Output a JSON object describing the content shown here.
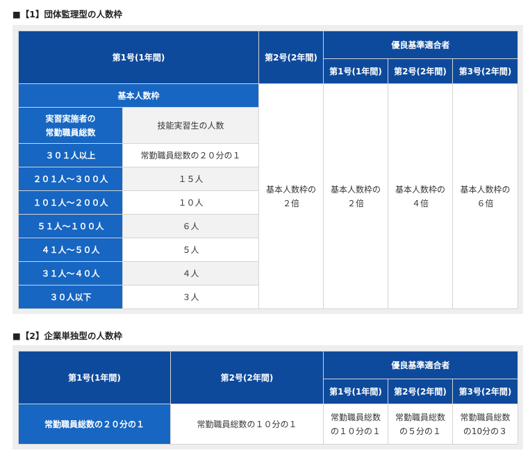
{
  "section1": {
    "title": "■【1】団体監理型の人数枠",
    "headers": {
      "first_year": "第1号(1年間)",
      "second_year": "第2号(2年間)",
      "excellent": "優良基準適合者",
      "ex_first": "第1号(1年間)",
      "ex_second": "第2号(2年間)",
      "ex_third": "第3号(2年間)"
    },
    "basic_quota_label": "基本人数枠",
    "col_left_header": "実習実施者の\n常勤職員総数",
    "col_right_header": "技能実習生の人数",
    "rows": [
      {
        "staff": "３０１人以上",
        "trainees": "常勤職員総数の２０分の１"
      },
      {
        "staff": "２０１人～３００人",
        "trainees": "１５人"
      },
      {
        "staff": "１０１人～２００人",
        "trainees": "１０人"
      },
      {
        "staff": "５１人～１００人",
        "trainees": "６人"
      },
      {
        "staff": "４１人～５０人",
        "trainees": "５人"
      },
      {
        "staff": "３１人～４０人",
        "trainees": "４人"
      },
      {
        "staff": "３０人以下",
        "trainees": "３人"
      }
    ],
    "second_year_value": "基本人数枠の\n２倍",
    "ex_first_value": "基本人数枠の\n２倍",
    "ex_second_value": "基本人数枠の\n４倍",
    "ex_third_value": "基本人数枠の\n６倍"
  },
  "section2": {
    "title": "■【2】企業単独型の人数枠",
    "headers": {
      "first_year": "第1号(1年間)",
      "second_year": "第2号(2年間)",
      "excellent": "優良基準適合者",
      "ex_first": "第1号(1年間)",
      "ex_second": "第2号(2年間)",
      "ex_third": "第3号(2年間)"
    },
    "first_year_value": "常勤職員総数の２０分の１",
    "second_year_value": "常勤職員総数の１０分の１",
    "ex_first_value": "常勤職員総数\nの１０分の１",
    "ex_second_value": "常勤職員総数\nの５分の１",
    "ex_third_value": "常勤職員総数\nの10分の３"
  }
}
